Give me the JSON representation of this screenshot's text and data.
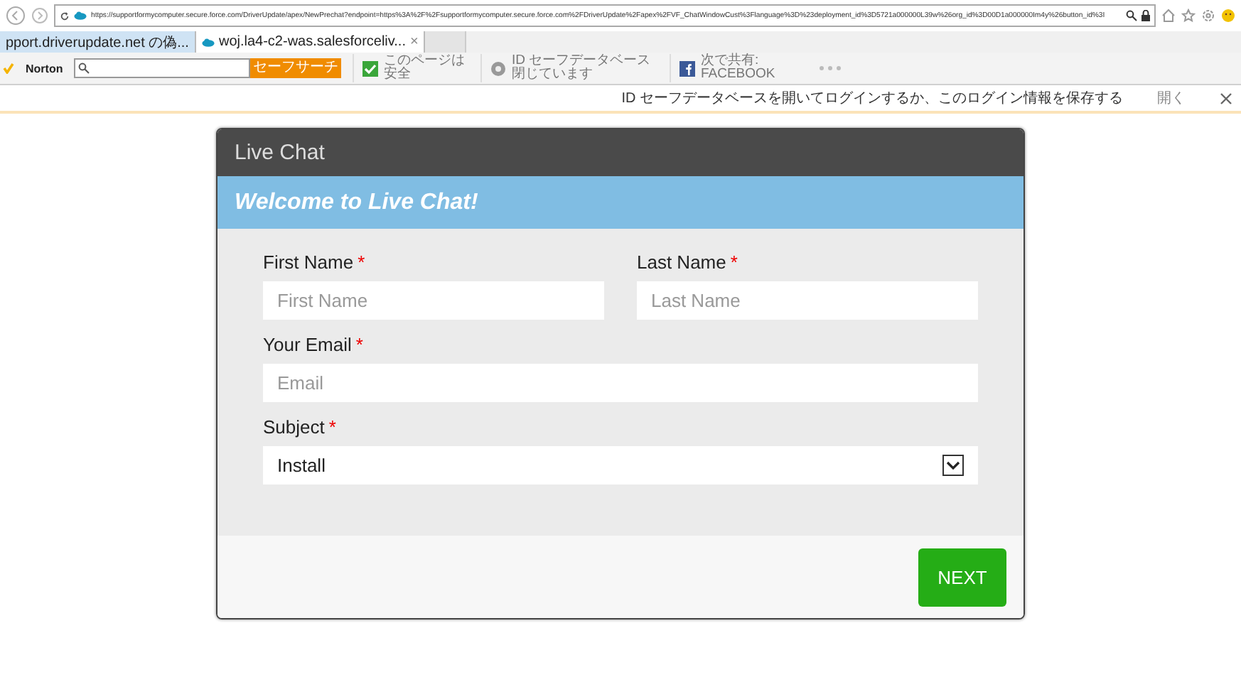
{
  "browser": {
    "url": "https://supportformycomputer.secure.force.com/DriverUpdate/apex/NewPrechat?endpoint=https%3A%2F%2Fsupportformycomputer.secure.force.com%2FDriverUpdate%2Fapex%2FVF_ChatWindowCust%3Flanguage%3D%23deployment_id%3D5721a000000L39w%26org_id%3D00D1a000000Im4y%26button_id%3I",
    "tabs": [
      {
        "label": "pport.driverupdate.net の偽...",
        "selected": false
      },
      {
        "label": "woj.la4-c2-was.salesforceliv...",
        "selected": true
      }
    ],
    "tab_close": "×",
    "toolbar": {
      "brand": "Norton",
      "search_button": "セーフサーチ",
      "items": [
        {
          "kind": "check",
          "line1": "このページは",
          "line2": "安全"
        },
        {
          "kind": "vault",
          "line1": "ID セーフデータベース",
          "line2": "閉じています"
        },
        {
          "kind": "facebook",
          "line1": "次で共有:",
          "line2": "FACEBOOK"
        }
      ]
    },
    "infobar": {
      "message": "ID セーフデータベースを開いてログインするか、このログイン情報を保存する",
      "action": "開く"
    }
  },
  "chat": {
    "title": "Live Chat",
    "welcome": "Welcome to Live Chat!",
    "asterisk": "*",
    "fields": [
      {
        "kind": "text",
        "label": "First Name",
        "required": true,
        "placeholder": "First Name",
        "wide": false
      },
      {
        "kind": "text",
        "label": "Last Name",
        "required": true,
        "placeholder": "Last Name",
        "wide": false
      },
      {
        "kind": "text",
        "label": "Your Email",
        "required": true,
        "placeholder": "Email",
        "wide": true
      },
      {
        "kind": "select",
        "label": "Subject",
        "required": true,
        "value": "Install",
        "wide": true
      }
    ],
    "next_button": "NEXT"
  }
}
